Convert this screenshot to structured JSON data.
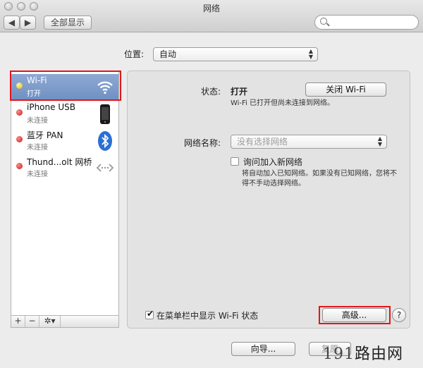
{
  "window": {
    "title": "网络",
    "show_all_label": "全部显示"
  },
  "location": {
    "label": "位置:",
    "value": "自动"
  },
  "sidebar": {
    "items": [
      {
        "name": "Wi-Fi",
        "status": "打开",
        "icon": "wifi-icon",
        "dot": "yellow",
        "selected": true
      },
      {
        "name": "iPhone USB",
        "status": "未连接",
        "icon": "iphone-icon",
        "dot": "red"
      },
      {
        "name": "蓝牙 PAN",
        "status": "未连接",
        "icon": "bluetooth-icon",
        "dot": "red"
      },
      {
        "name": "Thund...olt 网桥",
        "status": "未连接",
        "icon": "thunderbolt-bridge-icon",
        "dot": "red"
      }
    ],
    "tools": {
      "add": "+",
      "remove": "−",
      "gear": "✲▾"
    }
  },
  "detail": {
    "status_label": "状态:",
    "status_value": "打开",
    "turn_off_button": "关闭 Wi-Fi",
    "status_desc": "Wi-Fi 已打开但尚未连接到网络。",
    "network_name_label": "网络名称:",
    "network_name_placeholder": "没有选择网络",
    "ask_join_label": "询问加入新网络",
    "ask_join_desc_line1": "将自动加入已知网络。如果没有已知网络，您将不",
    "ask_join_desc_line2": "得不手动选择网络。",
    "show_status_label": "在菜单栏中显示 Wi-Fi 状态",
    "advanced_button": "高级...",
    "help_label": "?"
  },
  "bottom": {
    "assistant_button": "向导...",
    "revert_button": "复原"
  },
  "watermark": {
    "prefix": "191",
    "suffix": "路由网"
  },
  "colors": {
    "highlight_border": "#e0161b",
    "selected_row": "#7e9bcb"
  }
}
